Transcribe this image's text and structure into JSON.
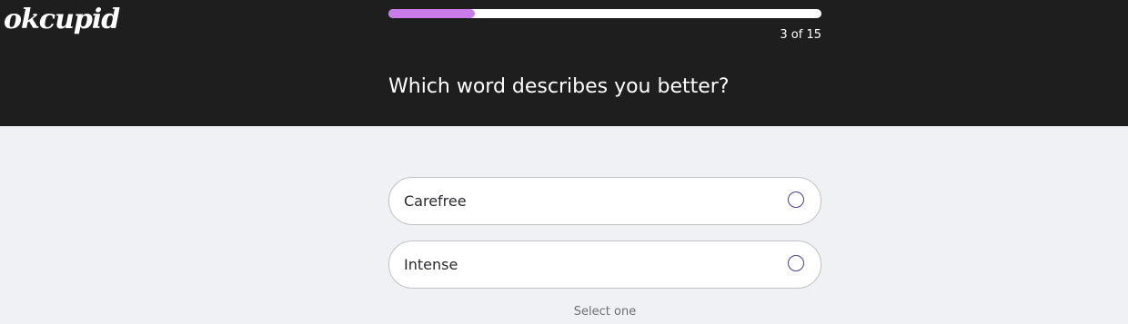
{
  "header": {
    "logo_text": "okcupid",
    "progress": {
      "current": 3,
      "total": 15,
      "fraction": 0.2,
      "label": "3 of 15",
      "fill_color": "#c97be9"
    },
    "question": "Which word describes you better?"
  },
  "options": [
    {
      "label": "Carefree",
      "icon": "radio-unchecked-icon"
    },
    {
      "label": "Intense",
      "icon": "radio-unchecked-icon"
    }
  ],
  "hint": "Select one",
  "colors": {
    "header_bg": "#1f1e1e",
    "page_bg": "#f0f1f4",
    "accent": "#c97be9",
    "radio_border": "#4a3c8c"
  }
}
